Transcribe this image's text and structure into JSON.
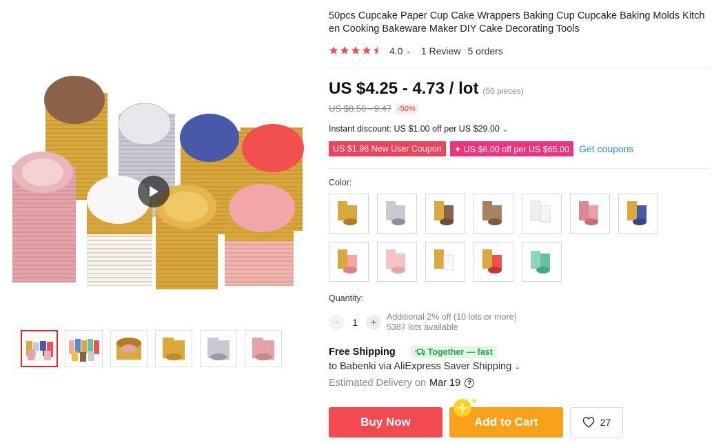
{
  "product": {
    "title": "50pcs Cupcake Paper Cup Cake Wrappers Baking Cup Cupcake Baking Molds Kitchen Cooking Bakeware Maker DIY Cake Decorating Tools",
    "rating_value": "4.0",
    "rating_fraction": 0.8,
    "reviews": "1 Review",
    "orders": "5 orders"
  },
  "price": {
    "current": "US $4.25 - 4.73 / lot",
    "lot_size": "(50 pieces)",
    "original": "US $8.50 - 9.47",
    "discount": "-50%"
  },
  "promo": {
    "instant_discount": "Instant discount: US $1.00 off per US $29.00",
    "coupon_new_user": "US $1.96 New User Coupon",
    "coupon_store": "✦ US $6.00 off per US $65.00",
    "get_coupons": "Get coupons"
  },
  "color": {
    "label": "Color:",
    "options": [
      {
        "name": "gold-mix"
      },
      {
        "name": "silver"
      },
      {
        "name": "gold-brown"
      },
      {
        "name": "brown"
      },
      {
        "name": "white"
      },
      {
        "name": "pink-rose"
      },
      {
        "name": "gold-blue"
      },
      {
        "name": "gold-pink"
      },
      {
        "name": "pink"
      },
      {
        "name": "gold-white"
      },
      {
        "name": "gold-red"
      },
      {
        "name": "mint"
      }
    ]
  },
  "quantity": {
    "label": "Quantity:",
    "value": "1",
    "additional_off": "Additional 2% off (10 lots or more)",
    "available": "5387 lots available"
  },
  "shipping": {
    "free": "Free Shipping",
    "badge": "Together — fast",
    "via": "to Babenki via AliExpress Saver Shipping",
    "estimated_label": "Estimated Delivery on",
    "estimated_date": "Mar 19"
  },
  "actions": {
    "buy_now": "Buy Now",
    "add_to_cart": "Add to Cart",
    "wishlist_count": "27"
  },
  "colors": {
    "accent_red": "#f34a52",
    "accent_orange": "#f9a11b",
    "coupon_pink": "#f0337f",
    "link_blue": "#2d8fc5",
    "star": "#f34a52"
  },
  "gallery": {
    "thumb_count": 6
  }
}
